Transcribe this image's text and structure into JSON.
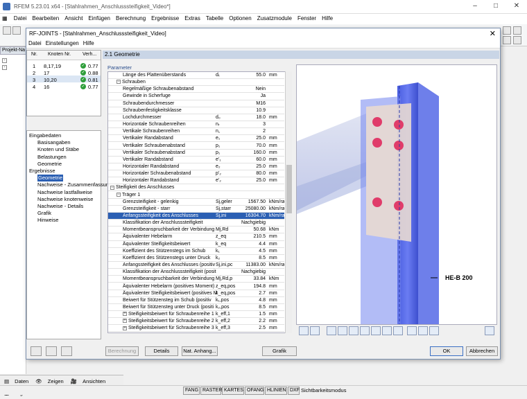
{
  "app": {
    "title": "RFEM 5.23.01 x64 - [Stahlrahmen_Anschlusssteifigkeit_Video*]",
    "menu": [
      "Datei",
      "Bearbeiten",
      "Ansicht",
      "Einfügen",
      "Berechnung",
      "Ergebnisse",
      "Extras",
      "Tabelle",
      "Optionen",
      "Zusatzmodule",
      "Fenster",
      "Hilfe"
    ],
    "navigator_title": "Projekt-Na",
    "nav_tabs": [
      "Daten",
      "Zeigen",
      "Ansichten",
      "Ergebni..."
    ],
    "status_buttons": [
      "FANG",
      "RASTER",
      "KARTES",
      "OFANG",
      "HLINIEN",
      "DXF"
    ],
    "status_text": "Sichtbarkeitsmodus"
  },
  "dialog": {
    "title": "RF-JOINTS - [Stahlrahmen_Anschlusssteifigkeit_Video]",
    "menu": [
      "Datei",
      "Einstellungen",
      "Hilfe"
    ],
    "node_table": {
      "headers": [
        "Nr.",
        "Knoten Nr.",
        "Verh..."
      ],
      "rows": [
        {
          "nr": "1",
          "nodes": "8,17,19",
          "ratio": "0.77"
        },
        {
          "nr": "2",
          "nodes": "17",
          "ratio": "0.88"
        },
        {
          "nr": "3",
          "nodes": "10,20",
          "ratio": "0.81"
        },
        {
          "nr": "4",
          "nodes": "16",
          "ratio": "0.77"
        }
      ]
    },
    "nav_list": [
      {
        "label": "Eingabedaten",
        "indent": 0
      },
      {
        "label": "Basisangaben",
        "indent": 1
      },
      {
        "label": "Knoten und Stäbe",
        "indent": 1
      },
      {
        "label": "Belastungen",
        "indent": 1
      },
      {
        "label": "Geometrie",
        "indent": 1
      },
      {
        "label": "Ergebnisse",
        "indent": 0
      },
      {
        "label": "Geometrie",
        "indent": 1,
        "selected": true
      },
      {
        "label": "Nachweise - Zusammenfassung",
        "indent": 1
      },
      {
        "label": "Nachweise lastfallweise",
        "indent": 1
      },
      {
        "label": "Nachweise knotenweise",
        "indent": 1
      },
      {
        "label": "Nachweise - Details",
        "indent": 1
      },
      {
        "label": "Grafik",
        "indent": 1
      },
      {
        "label": "Hinweise",
        "indent": 1
      }
    ],
    "section_title": "2.1 Geometrie",
    "param_label": "Parameter",
    "params": [
      {
        "t": "r",
        "l": "Länge des Plattenüberstands",
        "s": "dₜ",
        "v": "55.0",
        "u": "mm",
        "i": 2
      },
      {
        "t": "g",
        "l": "Schrauben",
        "i": 1
      },
      {
        "t": "r",
        "l": "Regelmäßige Schraubenabstand",
        "v2": "Nein",
        "i": 2
      },
      {
        "t": "r",
        "l": "Gewinde in Scherfuge",
        "v2": "Ja",
        "i": 2
      },
      {
        "t": "r",
        "l": "Schraubendurchmesser",
        "v2": "M16",
        "i": 2
      },
      {
        "t": "r",
        "l": "Schraubenfestigkeitsklasse",
        "v2": "10.9",
        "i": 2
      },
      {
        "t": "r",
        "l": "Lochdurchmesser",
        "s": "d₀",
        "v": "18.0",
        "u": "mm",
        "i": 2
      },
      {
        "t": "r",
        "l": "Horizontale Schraubenreihen",
        "s": "nᵣ",
        "v": "3",
        "u": "",
        "i": 2
      },
      {
        "t": "r",
        "l": "Vertikale Schraubenreihen",
        "s": "n꜀",
        "v": "2",
        "u": "",
        "i": 2
      },
      {
        "t": "r",
        "l": "Vertikaler Randabstand",
        "s": "e₁",
        "v": "25.0",
        "u": "mm",
        "i": 2
      },
      {
        "t": "r",
        "l": "Vertikaler Schraubenabstand",
        "s": "p₁",
        "v": "70.0",
        "u": "mm",
        "i": 2
      },
      {
        "t": "r",
        "l": "Vertikaler Schraubenabstand",
        "s": "p₁",
        "v": "160.0",
        "u": "mm",
        "i": 2
      },
      {
        "t": "r",
        "l": "Vertikaler Randabstand",
        "s": "e'₁",
        "v": "60.0",
        "u": "mm",
        "i": 2
      },
      {
        "t": "r",
        "l": "Horizontaler Randabstand",
        "s": "e₂",
        "v": "25.0",
        "u": "mm",
        "i": 2
      },
      {
        "t": "r",
        "l": "Horizontaler Schraubenabstand",
        "s": "p'₂",
        "v": "80.0",
        "u": "mm",
        "i": 2
      },
      {
        "t": "r",
        "l": "Horizontaler Randabstand",
        "s": "e'₂",
        "v": "25.0",
        "u": "mm",
        "i": 2
      },
      {
        "t": "g",
        "l": "Steifigkeit des Anschlusses",
        "i": 0
      },
      {
        "t": "g",
        "l": "Träger 1",
        "i": 1
      },
      {
        "t": "r",
        "l": "Grenzsteifigkeit - gelenkig",
        "s": "Sj,geler",
        "v": "1567.50",
        "u": "kNm/ra",
        "i": 2
      },
      {
        "t": "r",
        "l": "Grenzsteifigkeit - starr",
        "s": "Sj,starr",
        "v": "25080.00",
        "u": "kNm/ra",
        "i": 2
      },
      {
        "t": "r",
        "l": "Anfangssteifigkeit des Anschlusses",
        "s": "Sj,ini",
        "v": "16304.70",
        "u": "kNm/ra",
        "i": 2,
        "sel": true
      },
      {
        "t": "r",
        "l": "Klassifikation der Anschlusssteifigkeit",
        "v2": "Nachgiebig",
        "i": 2
      },
      {
        "t": "r",
        "l": "Momentbeanspruchbarkeit der Verbindung",
        "s": "Mj,Rd",
        "v": "50.68",
        "u": "kNm",
        "i": 2
      },
      {
        "t": "r",
        "l": "Äquivalenter Hebelarm",
        "s": "z_eq",
        "v": "210.5",
        "u": "mm",
        "i": 2
      },
      {
        "t": "r",
        "l": "Äquivalenter Steifigkeitsbeiwert",
        "s": "k_eq",
        "v": "4.4",
        "u": "mm",
        "i": 2
      },
      {
        "t": "r",
        "l": "Koeffizient des Stützenstegs im Schub",
        "s": "k₁",
        "v": "4.5",
        "u": "mm",
        "i": 2
      },
      {
        "t": "r",
        "l": "Koeffizient des Stützenstegs unter Druck",
        "s": "k₂",
        "v": "8.5",
        "u": "mm",
        "i": 2
      },
      {
        "t": "r",
        "l": "Anfangssteifigkeit des Anschlusses (positiv",
        "s": "Sj,ini,pc",
        "v": "11383.00",
        "u": "kNm/ra",
        "i": 2
      },
      {
        "t": "r",
        "l": "Klassifikation der Anschlusssteifigkeit (posit",
        "v2": "Nachgiebig",
        "i": 2
      },
      {
        "t": "r",
        "l": "Momentbeanspruchbarkeit der Verbindung",
        "s": "Mj,Rd,p",
        "v": "33.84",
        "u": "kNm",
        "i": 2
      },
      {
        "t": "r",
        "l": "Äquivalenter Hebelarm (positives Moment)",
        "s": "z_eq,pos",
        "v": "194.8",
        "u": "mm",
        "i": 2
      },
      {
        "t": "r",
        "l": "Äquivalenter Steifigkeitsbeiwert (positives M",
        "s": "k_eq,pos",
        "v": "2.7",
        "u": "mm",
        "i": 2
      },
      {
        "t": "r",
        "l": "Beiwert für Stützensteg im Schub (positiv",
        "s": "k₁,pos",
        "v": "4.8",
        "u": "mm",
        "i": 2
      },
      {
        "t": "r",
        "l": "Beiwert für Stützensteg unter Druck (positi",
        "s": "k₂,pos",
        "v": "8.5",
        "u": "mm",
        "i": 2
      },
      {
        "t": "x",
        "l": "Steifigkeitsbeiwert für Schraubenreihe 1",
        "s": "k_eff,1",
        "v": "1.5",
        "u": "mm",
        "i": 2
      },
      {
        "t": "x",
        "l": "Steifigkeitsbeiwert für Schraubenreihe 2",
        "s": "k_eff,2",
        "v": "2.2",
        "u": "mm",
        "i": 2
      },
      {
        "t": "x",
        "l": "Steifigkeitsbeiwert für Schraubenreihe 3",
        "s": "k_eff,3",
        "v": "2.5",
        "u": "mm",
        "i": 2
      }
    ],
    "graphic_label": "HE-B 200",
    "buttons": {
      "berechnung": "Berechnung",
      "details": "Details",
      "nat_anhang": "Nat. Anhang...",
      "grafik": "Grafik",
      "ok": "OK",
      "abbrechen": "Abbrechen"
    }
  }
}
